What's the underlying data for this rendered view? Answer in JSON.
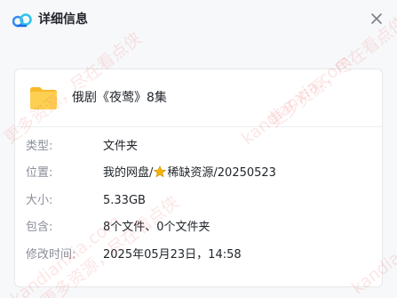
{
  "header": {
    "title": "详细信息"
  },
  "file": {
    "name": "俄剧《夜莺》8集"
  },
  "details": {
    "type_label": "类型:",
    "type_value": "文件夹",
    "location_label": "位置:",
    "location_prefix": "我的网盘/",
    "location_suffix": "稀缺资源/20250523",
    "size_label": "大小:",
    "size_value": "5.33GB",
    "contains_label": "包含:",
    "contains_value": "8个文件、0个文件夹",
    "modified_label": "修改时间:",
    "modified_value": "2025年05月23日，14:58"
  },
  "watermark": {
    "text_a": "kandianxia.com",
    "text_b": "更多资源，尽在看点侠"
  },
  "colors": {
    "folder": "#fdc83c",
    "logo_blue": "#3b8bf5",
    "star": "#f5b400"
  },
  "icons": {
    "logo": "cloud-logo-icon",
    "close": "close-icon",
    "folder": "folder-icon",
    "star": "star-icon"
  }
}
